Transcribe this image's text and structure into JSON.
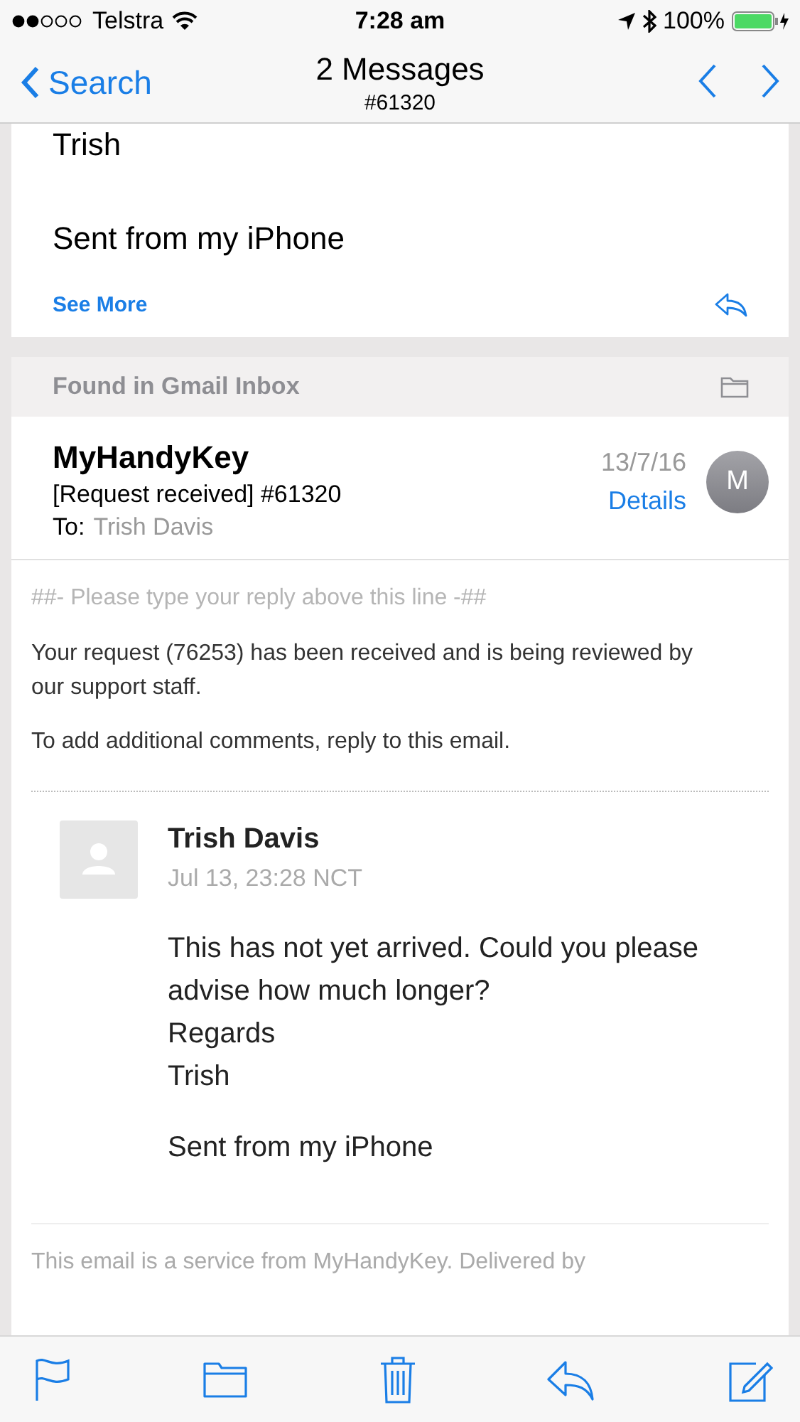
{
  "status_bar": {
    "carrier": "Telstra",
    "time": "7:28 am",
    "battery": "100%"
  },
  "nav": {
    "back": "Search",
    "title": "2 Messages",
    "subtitle": "#61320"
  },
  "previous_message": {
    "lines": [
      "Trish",
      "Sent from my iPhone"
    ],
    "see_more": "See More"
  },
  "message": {
    "found_in": "Found in Gmail Inbox",
    "sender": "MyHandyKey",
    "subject": "[Request received] #61320",
    "to_label": "To:",
    "to": "Trish Davis",
    "date": "13/7/16",
    "details": "Details",
    "avatar": "M",
    "reply_marker": "##- Please type your reply above this line -##",
    "paragraphs": [
      "Your request (76253) has been received and is being reviewed by our support staff.",
      "To add additional comments, reply to this email."
    ],
    "comment": {
      "author": "Trish Davis",
      "time": "Jul 13, 23:28 NCT",
      "text": "This has not yet arrived. Could you please advise how much longer?",
      "lines": [
        "Regards",
        "Trish"
      ],
      "signature": "Sent from my iPhone"
    },
    "footer": "This email is a service from MyHandyKey. Delivered by"
  }
}
